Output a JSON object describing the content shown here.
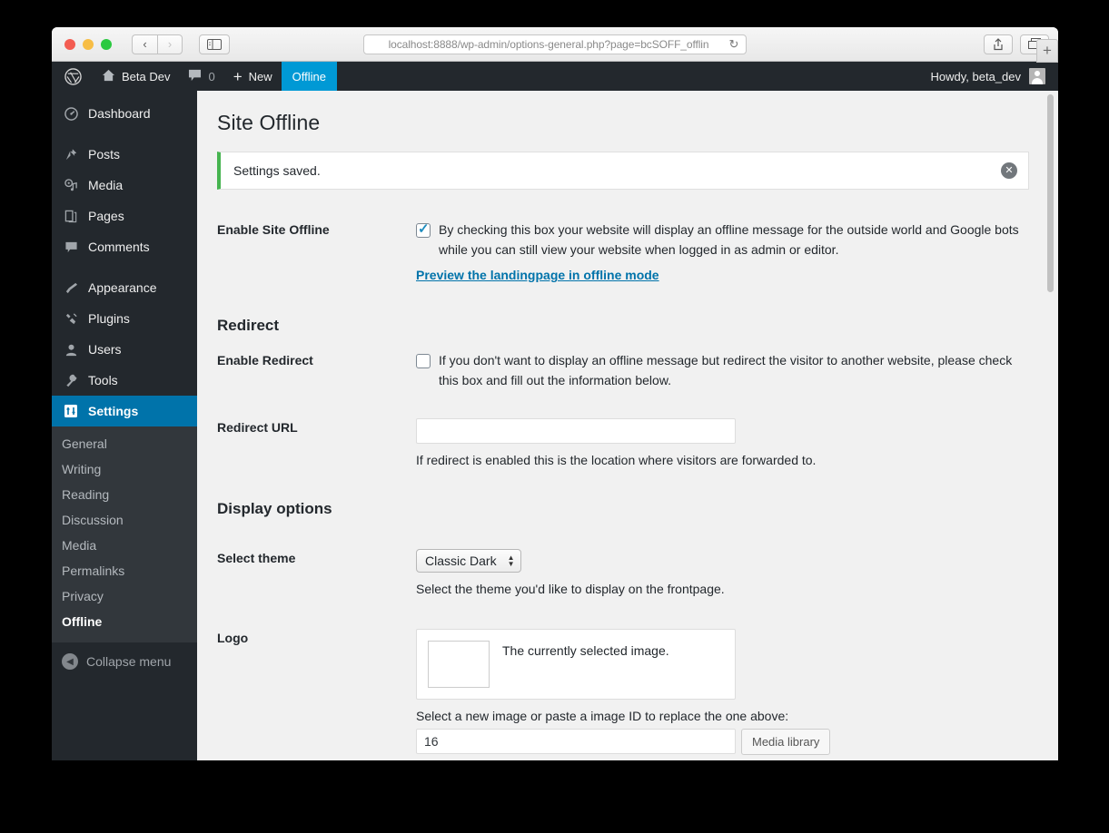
{
  "browser": {
    "url": "localhost:8888/wp-admin/options-general.php?page=bcSOFF_offlin",
    "reload_icon": "reload-icon",
    "back_icon": "‹",
    "forward_icon": "›",
    "sidebar_toggle_icon": "sidebar-toggle-icon",
    "share_icon": "share-icon",
    "tabs_icon": "tabs-overview-icon",
    "new_tab_icon": "+"
  },
  "adminbar": {
    "logo_icon": "wordpress-logo-icon",
    "site_icon": "home-icon",
    "site_name": "Beta Dev",
    "comments_icon": "comment-bubble-icon",
    "comments_count": "0",
    "new_icon": "+",
    "new_label": "New",
    "active_label": "Offline",
    "howdy": "Howdy, beta_dev"
  },
  "sidebar": {
    "items": [
      {
        "label": "Dashboard",
        "icon": "dashboard-icon",
        "glyph": "◉"
      },
      {
        "label": "Posts",
        "icon": "pin-icon",
        "glyph": "✒"
      },
      {
        "label": "Media",
        "icon": "media-icon",
        "glyph": "♪"
      },
      {
        "label": "Pages",
        "icon": "pages-icon",
        "glyph": "❏"
      },
      {
        "label": "Comments",
        "icon": "comment-icon",
        "glyph": "💬"
      },
      {
        "label": "Appearance",
        "icon": "brush-icon",
        "glyph": "✎"
      },
      {
        "label": "Plugins",
        "icon": "plug-icon",
        "glyph": "⚡"
      },
      {
        "label": "Users",
        "icon": "user-icon",
        "glyph": "👤"
      },
      {
        "label": "Tools",
        "icon": "wrench-icon",
        "glyph": "🔧"
      },
      {
        "label": "Settings",
        "icon": "settings-icon",
        "glyph": "⚙"
      }
    ],
    "submenu": [
      "General",
      "Writing",
      "Reading",
      "Discussion",
      "Media",
      "Permalinks",
      "Privacy",
      "Offline"
    ],
    "submenu_current": "Offline",
    "collapse_label": "Collapse menu",
    "collapse_icon": "chevron-left-circle-icon"
  },
  "main": {
    "page_title": "Site Offline",
    "notice": {
      "message": "Settings saved.",
      "dismiss_icon": "✕",
      "accent_color": "#46b450"
    },
    "enable_offline": {
      "label": "Enable Site Offline",
      "checked": true,
      "description": "By checking this box your website will display an offline message for the outside world and Google bots while you can still view your website when logged in as admin or editor.",
      "link": "Preview the landingpage in offline mode"
    },
    "redirect": {
      "heading": "Redirect",
      "enable_label": "Enable Redirect",
      "enable_checked": false,
      "enable_description": "If you don't want to display an offline message but redirect the visitor to another website, please check this box and fill out the information below.",
      "url_label": "Redirect URL",
      "url_value": "",
      "url_placeholder": "",
      "url_description": "If redirect is enabled this is the location where visitors are forwarded to."
    },
    "display": {
      "heading": "Display options",
      "theme_label": "Select theme",
      "theme_value": "Classic Dark",
      "theme_options": [
        "Classic Dark"
      ],
      "theme_description": "Select the theme you'd like to display on the frontpage.",
      "logo_label": "Logo",
      "logo_caption": "The currently selected image.",
      "logo_pick_description": "Select a new image or paste a image ID to replace the one above:",
      "logo_id_value": "16",
      "media_button": "Media library"
    }
  },
  "colors": {
    "wp_blue": "#0073aa",
    "wp_active_blue": "#0099d5",
    "admin_dark": "#23282d",
    "submenu_dark": "#32373c",
    "notice_green": "#46b450",
    "page_bg": "#f1f1f1"
  }
}
